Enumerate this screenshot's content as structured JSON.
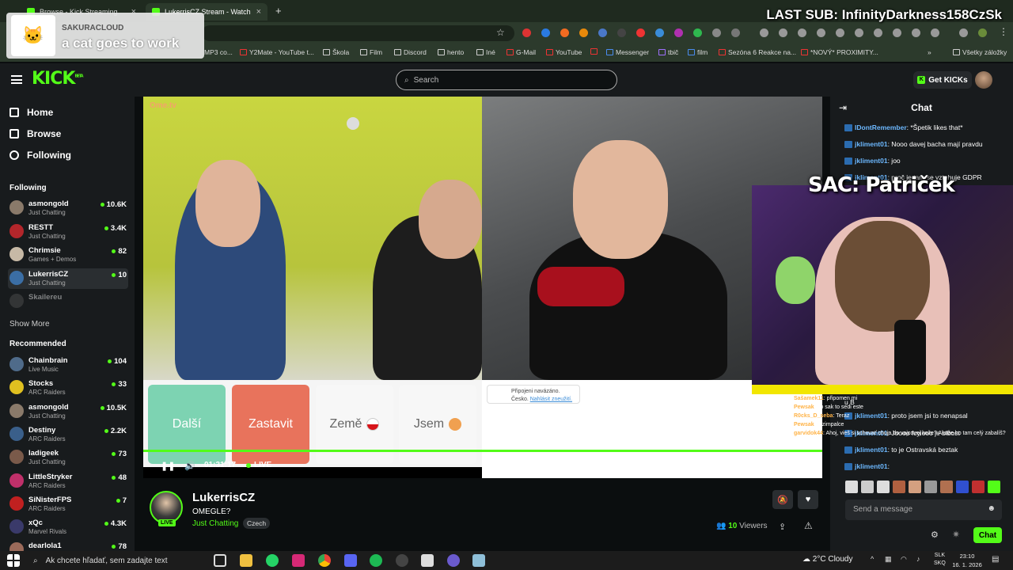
{
  "browser": {
    "tabs": [
      {
        "label": "Browse - Kick Streaming"
      },
      {
        "label": "LukerrisCZ Stream - Watch"
      }
    ],
    "new_tab_label": "+",
    "bookmarks": [
      {
        "label": "MP3 co..."
      },
      {
        "label": "Y2Mate - YouTube t..."
      },
      {
        "label": "Škola"
      },
      {
        "label": "Film"
      },
      {
        "label": "Discord"
      },
      {
        "label": "hento"
      },
      {
        "label": "Iné"
      },
      {
        "label": "G-Mail"
      },
      {
        "label": "YouTube"
      },
      {
        "label": "Messenger"
      },
      {
        "label": "tbič"
      },
      {
        "label": "film"
      },
      {
        "label": "Sezóna 6 Reakce na..."
      },
      {
        "label": "*NOVÝ* PROXIMITY..."
      },
      {
        "label": "Všetky záložky"
      }
    ]
  },
  "overlay": {
    "last_sub": "LAST SUB: InfinityDarkness158CzSk",
    "notification_name": "SAKURACLOUD",
    "notification_msg": "a cat goes to work",
    "webcam_name": "SAC: Patriček",
    "chat_lines": [
      {
        "user": "Sašamek11",
        "text": ": připomen mi"
      },
      {
        "user": "Pewsak",
        "text": ": no sak to sedi este"
      },
      {
        "user": "R0cks_D_seba",
        "text": ": Teraz"
      },
      {
        "user": "Pewsak",
        "text": ": drzimpalce"
      },
      {
        "user": "garvidok44",
        "text": ": Ahoj, vieš si schovať chuja do vajcovej kože? Akože ho tam celý zabalíš?"
      }
    ]
  },
  "kick": {
    "logo": "KICK",
    "logo_tag": "BETA",
    "search_placeholder": "Search",
    "get_kicks": "Get KICKs"
  },
  "sidebar": {
    "nav": [
      {
        "label": "Home"
      },
      {
        "label": "Browse"
      },
      {
        "label": "Following"
      }
    ],
    "following_title": "Following",
    "following": [
      {
        "name": "asmongold",
        "category": "Just Chatting",
        "viewers": "10.6K",
        "color": "#8a7a6a"
      },
      {
        "name": "RESTT",
        "category": "Just Chatting",
        "viewers": "3.4K",
        "color": "#b3262b"
      },
      {
        "name": "Chrimsie",
        "category": "Games + Demos",
        "viewers": "82",
        "color": "#c7b9a6"
      },
      {
        "name": "LukerrisCZ",
        "category": "Just Chatting",
        "viewers": "10",
        "color": "#3b6ea5"
      },
      {
        "name": "Skailereu",
        "category": "",
        "viewers": "",
        "color": "#555"
      }
    ],
    "show_more": "Show More",
    "recommended_title": "Recommended",
    "recommended": [
      {
        "name": "Chainbrain",
        "category": "Live Music",
        "viewers": "104",
        "color": "#4f6b8a"
      },
      {
        "name": "Stocks",
        "category": "ARC Raiders",
        "viewers": "33",
        "color": "#e0c020"
      },
      {
        "name": "asmongold",
        "category": "Just Chatting",
        "viewers": "10.5K",
        "color": "#8a7a6a"
      },
      {
        "name": "Destiny",
        "category": "ARC Raiders",
        "viewers": "2.2K",
        "color": "#3a5f8a"
      },
      {
        "name": "ladigeek",
        "category": "Just Chatting",
        "viewers": "73",
        "color": "#7a5a4a"
      },
      {
        "name": "LittleStryker",
        "category": "ARC Raiders",
        "viewers": "48",
        "color": "#c0306a"
      },
      {
        "name": "SiNisterFPS",
        "category": "ARC Raiders",
        "viewers": "7",
        "color": "#c02020"
      },
      {
        "name": "xQc",
        "category": "Marvel Rivals",
        "viewers": "4.3K",
        "color": "#3a3a6a"
      },
      {
        "name": "dearlola1",
        "category": "",
        "viewers": "78",
        "color": "#9a6a5a"
      }
    ]
  },
  "video": {
    "ome_logo": "Ome.tv",
    "buttons": [
      {
        "label": "Další",
        "bg": "#7dd3b2",
        "fg": "#ffffff"
      },
      {
        "label": "Zastavit",
        "bg": "#e8735c",
        "fg": "#ffffff"
      },
      {
        "label": "Země",
        "bg": "#f7f7f7",
        "fg": "#666666"
      },
      {
        "label": "Jsem",
        "bg": "#f7f7f7",
        "fg": "#666666"
      }
    ],
    "status_line1": "Připojeni navázáno.",
    "status_line2_prefix": "Česko. ",
    "status_line2_link": "Nahlásit zneužití.",
    "time": "01:31:17",
    "live": "LIVE"
  },
  "stream": {
    "channel": "LukerrisCZ",
    "title": "OMEGLE?",
    "category": "Just Chatting",
    "language": "Czech",
    "viewers_count": "10",
    "viewers_label": "Viewers",
    "live_badge": "LIVE"
  },
  "chat": {
    "title": "Chat",
    "messages": [
      {
        "user": "IDontRemember",
        "text": ": *Špetik likes that*"
      },
      {
        "user": "jkliment01",
        "text": ": Nooo davej bacha mají pravdu"
      },
      {
        "user": "jkliment01",
        "text": ": joo"
      },
      {
        "user": "jkliment01",
        "text": ": proč je tam se vztahuje GDPR"
      },
      {
        "user": "",
        "text": "u B"
      },
      {
        "user": "jkliment01",
        "text": ": proto jsem jsi to nenapsal"
      },
      {
        "user": "",
        "text": ""
      },
      {
        "user": "jkliment01",
        "text": ": Joooo fcyiooo je blbost"
      },
      {
        "user": "jkliment01",
        "text": ": to je Ostravská beztak"
      },
      {
        "user": "",
        "text": ""
      },
      {
        "user": "jkliment01",
        "text": ":"
      }
    ],
    "input_placeholder": "Send a message",
    "send_label": "Chat"
  },
  "taskbar": {
    "search_placeholder": "Ak chcete hľadať, sem zadajte text",
    "weather": "2°C  Cloudy",
    "lang1": "SLK",
    "lang2": "SKQ",
    "time": "23:10",
    "date": "16. 1. 2026"
  }
}
